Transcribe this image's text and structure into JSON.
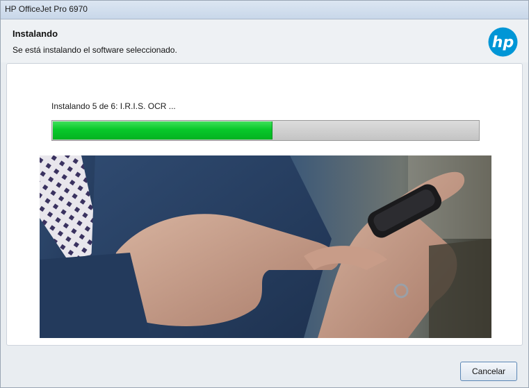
{
  "window": {
    "title": "HP OfficeJet Pro 6970"
  },
  "header": {
    "title": "Instalando",
    "subtitle": "Se está instalando el software seleccionado.",
    "logo_text": "hp"
  },
  "install": {
    "status": "Instalando 5 de 6: I.R.I.S. OCR ...",
    "progress_percent": 51.5,
    "progress_color": "#08c82a"
  },
  "footer": {
    "cancel_label": "Cancelar"
  },
  "colors": {
    "hp_blue": "#0096d6",
    "accent_border": "#5a86b5"
  }
}
